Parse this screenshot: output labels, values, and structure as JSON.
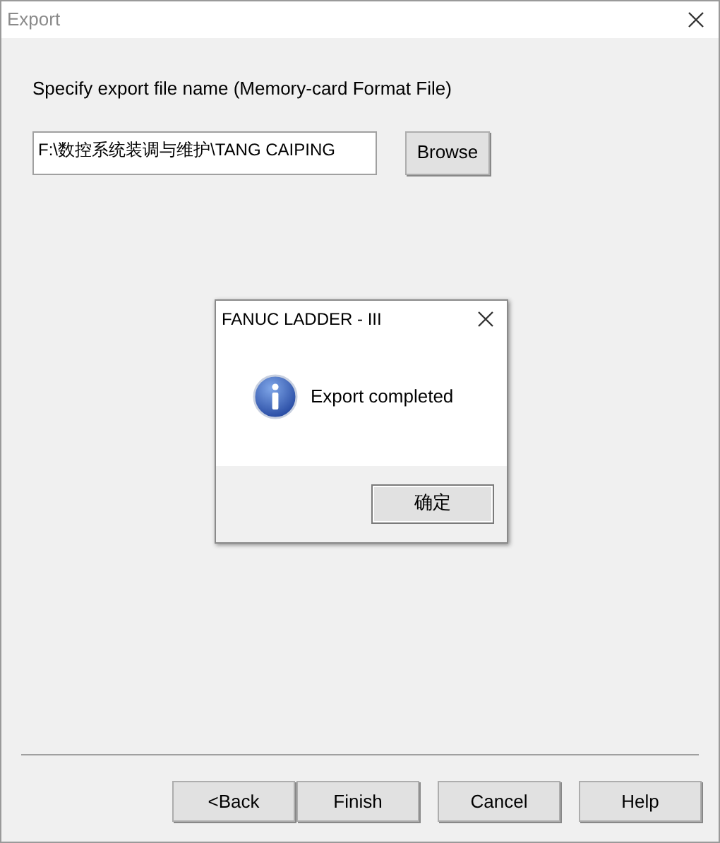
{
  "window": {
    "title": "Export"
  },
  "prompt": "Specify export file name (Memory-card Format File)",
  "file_field": {
    "value": "F:\\数控系统装调与维护\\TANG CAIPING"
  },
  "browse_button": "Browse",
  "buttons": [
    "<Back",
    "Finish",
    "Cancel",
    "Help"
  ],
  "message_box": {
    "title": "FANUC LADDER - III",
    "message": "Export completed",
    "ok_button": "确定"
  }
}
